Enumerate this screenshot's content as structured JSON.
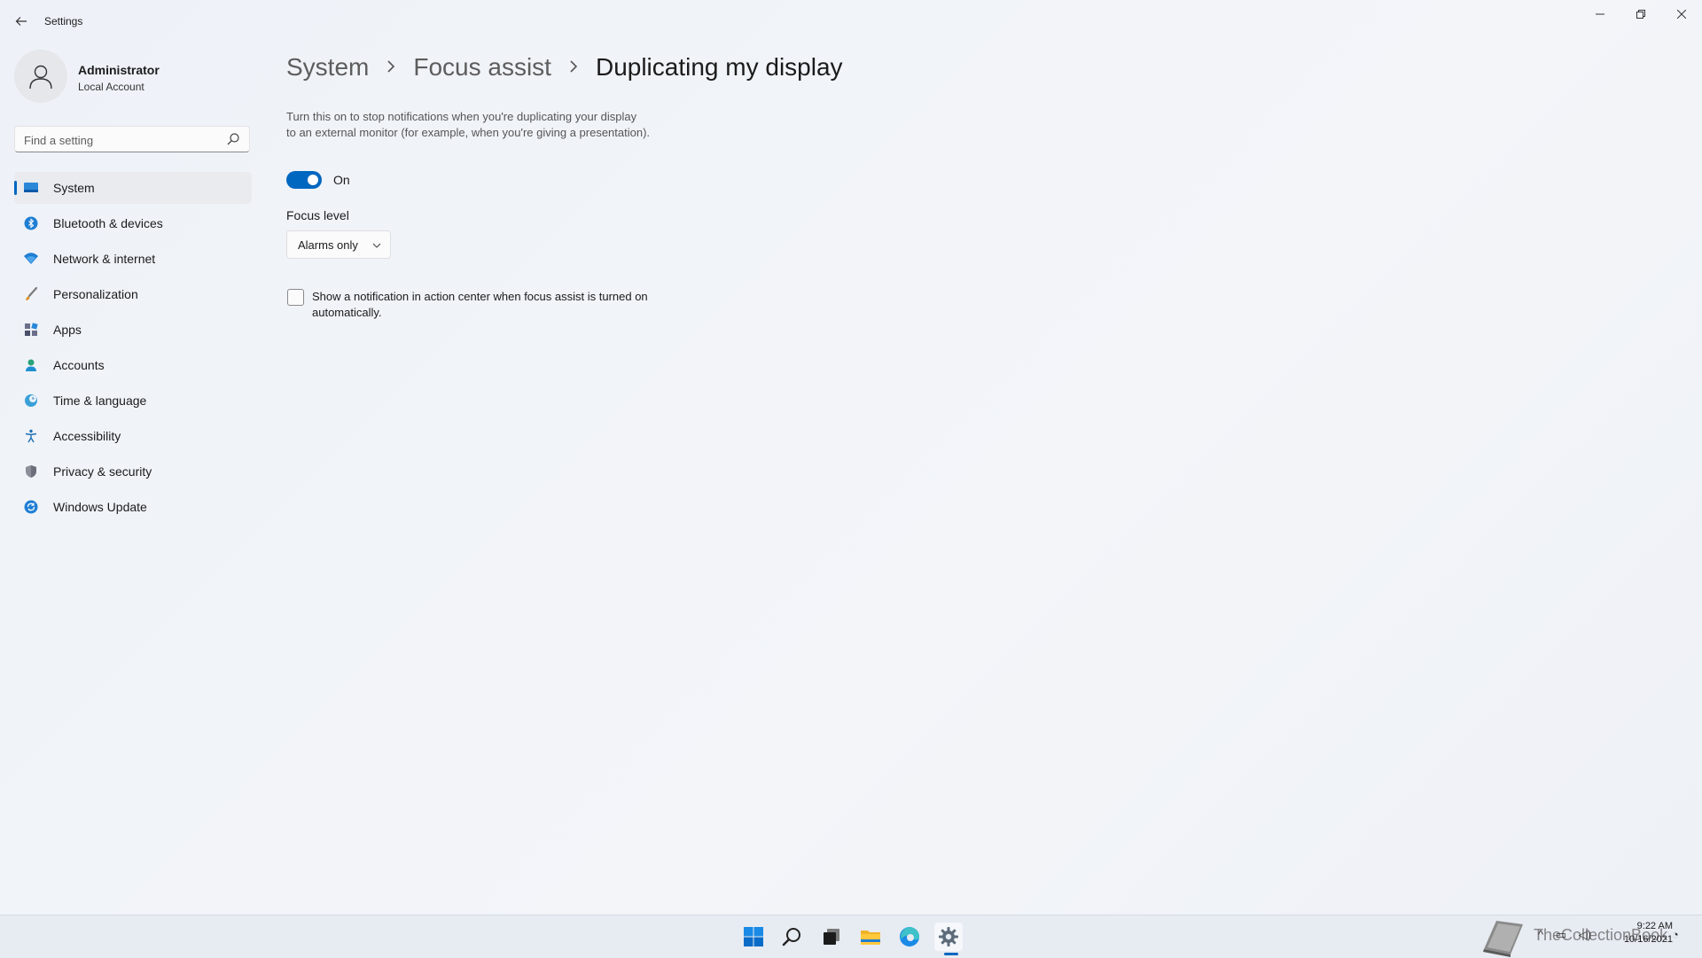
{
  "window": {
    "title": "Settings",
    "back_icon": "arrow-left-icon",
    "minimize_icon": "minimize-icon",
    "maximize_icon": "restore-icon",
    "close_icon": "close-icon"
  },
  "profile": {
    "name": "Administrator",
    "account_type": "Local Account"
  },
  "search": {
    "placeholder": "Find a setting",
    "value": ""
  },
  "sidebar": {
    "items": [
      {
        "label": "System",
        "icon": "monitor-icon",
        "active": true
      },
      {
        "label": "Bluetooth & devices",
        "icon": "bluetooth-icon",
        "active": false
      },
      {
        "label": "Network & internet",
        "icon": "wifi-icon",
        "active": false
      },
      {
        "label": "Personalization",
        "icon": "brush-icon",
        "active": false
      },
      {
        "label": "Apps",
        "icon": "apps-icon",
        "active": false
      },
      {
        "label": "Accounts",
        "icon": "person-icon",
        "active": false
      },
      {
        "label": "Time & language",
        "icon": "globe-clock-icon",
        "active": false
      },
      {
        "label": "Accessibility",
        "icon": "accessibility-icon",
        "active": false
      },
      {
        "label": "Privacy & security",
        "icon": "shield-icon",
        "active": false
      },
      {
        "label": "Windows Update",
        "icon": "update-icon",
        "active": false
      }
    ]
  },
  "breadcrumb": {
    "items": [
      "System",
      "Focus assist"
    ],
    "current": "Duplicating my display"
  },
  "main": {
    "description_line1": "Turn this on to stop notifications when you're duplicating your display",
    "description_line2": "to an external monitor (for example, when you're giving a presentation).",
    "toggle_state": "On",
    "toggle_on": true,
    "focus_level_label": "Focus level",
    "focus_level_value": "Alarms only",
    "checkbox_checked": false,
    "checkbox_label_line1": "Show a notification in action center when focus assist is turned on",
    "checkbox_label_line2": "automatically."
  },
  "taskbar": {
    "icons": [
      "windows-start-icon",
      "search-icon",
      "task-view-icon",
      "file-explorer-icon",
      "edge-icon",
      "settings-gear-icon"
    ],
    "watermark": "TheCollectionBook",
    "time": "9:22 AM",
    "date": "10/16/2021"
  },
  "colors": {
    "accent": "#0067c0",
    "background": "#f2f4f8",
    "taskbar": "#e7ebf2"
  }
}
